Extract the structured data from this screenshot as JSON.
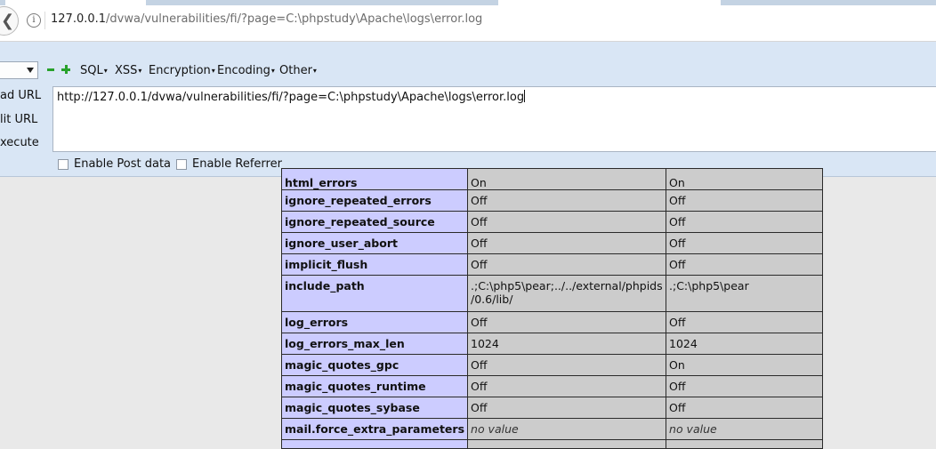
{
  "browser": {
    "url_host": "127.0.0.1",
    "url_path": "/dvwa/vulnerabilities/fi/?page=C:\\phpstudy\\Apache\\logs\\error.log"
  },
  "hackbar": {
    "menus": [
      "SQL",
      "XSS",
      "Encryption",
      "Encoding",
      "Other"
    ],
    "side_buttons": [
      "ad URL",
      "lit URL",
      "xecute"
    ],
    "url_text": "http://127.0.0.1/dvwa/vulnerabilities/fi/?page=C:\\phpstudy\\Apache\\logs\\error.log",
    "enable_post": "Enable Post data",
    "enable_referrer": "Enable Referrer"
  },
  "phpinfo_rows": [
    {
      "directive": "html_errors",
      "local": "On",
      "master": "On"
    },
    {
      "directive": "ignore_repeated_errors",
      "local": "Off",
      "master": "Off"
    },
    {
      "directive": "ignore_repeated_source",
      "local": "Off",
      "master": "Off"
    },
    {
      "directive": "ignore_user_abort",
      "local": "Off",
      "master": "Off"
    },
    {
      "directive": "implicit_flush",
      "local": "Off",
      "master": "Off"
    },
    {
      "directive": "include_path",
      "local_line1": ".;C:\\php5\\pear;../../external/phpids",
      "local_line2": "/0.6/lib/",
      "master": ".;C:\\php5\\pear"
    },
    {
      "directive": "log_errors",
      "local": "Off",
      "master": "Off"
    },
    {
      "directive": "log_errors_max_len",
      "local": "1024",
      "master": "1024"
    },
    {
      "directive": "magic_quotes_gpc",
      "local": "Off",
      "master": "On"
    },
    {
      "directive": "magic_quotes_runtime",
      "local": "Off",
      "master": "Off"
    },
    {
      "directive": "magic_quotes_sybase",
      "local": "Off",
      "master": "Off"
    },
    {
      "directive": "mail.force_extra_parameters",
      "local": "no value",
      "master": "no value"
    }
  ]
}
